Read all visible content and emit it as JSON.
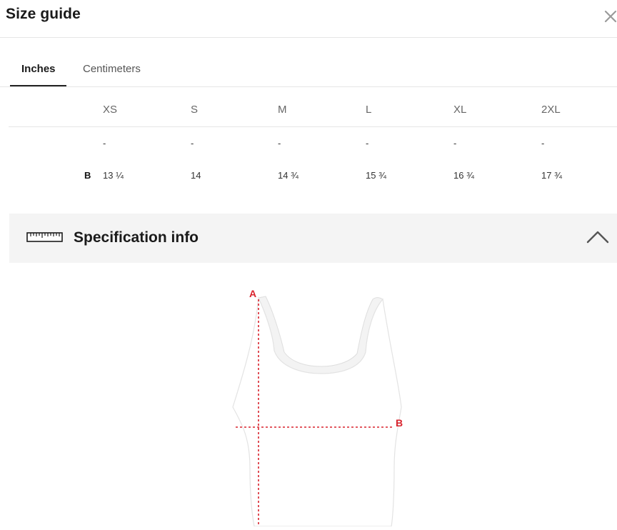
{
  "header": {
    "title": "Size guide",
    "close_glyph": "✕"
  },
  "tabs": [
    {
      "label": "Inches",
      "active": true
    },
    {
      "label": "Centimeters",
      "active": false
    }
  ],
  "sizes": [
    "XS",
    "S",
    "M",
    "L",
    "XL",
    "2XL"
  ],
  "rows": [
    {
      "label": "",
      "values": [
        "-",
        "-",
        "-",
        "-",
        "-",
        "-"
      ]
    },
    {
      "label": "B",
      "values": [
        "13 ¼",
        "14",
        "14 ¾",
        "15 ¾",
        "16 ¾",
        "17 ¾"
      ]
    }
  ],
  "spec": {
    "title": "Specification info",
    "icon": "ruler-icon",
    "toggle_icon": "chevron-up-icon"
  },
  "diagram": {
    "label_a": "A",
    "label_b": "B",
    "measure_color": "#d9232d",
    "garment": "tank-top"
  }
}
